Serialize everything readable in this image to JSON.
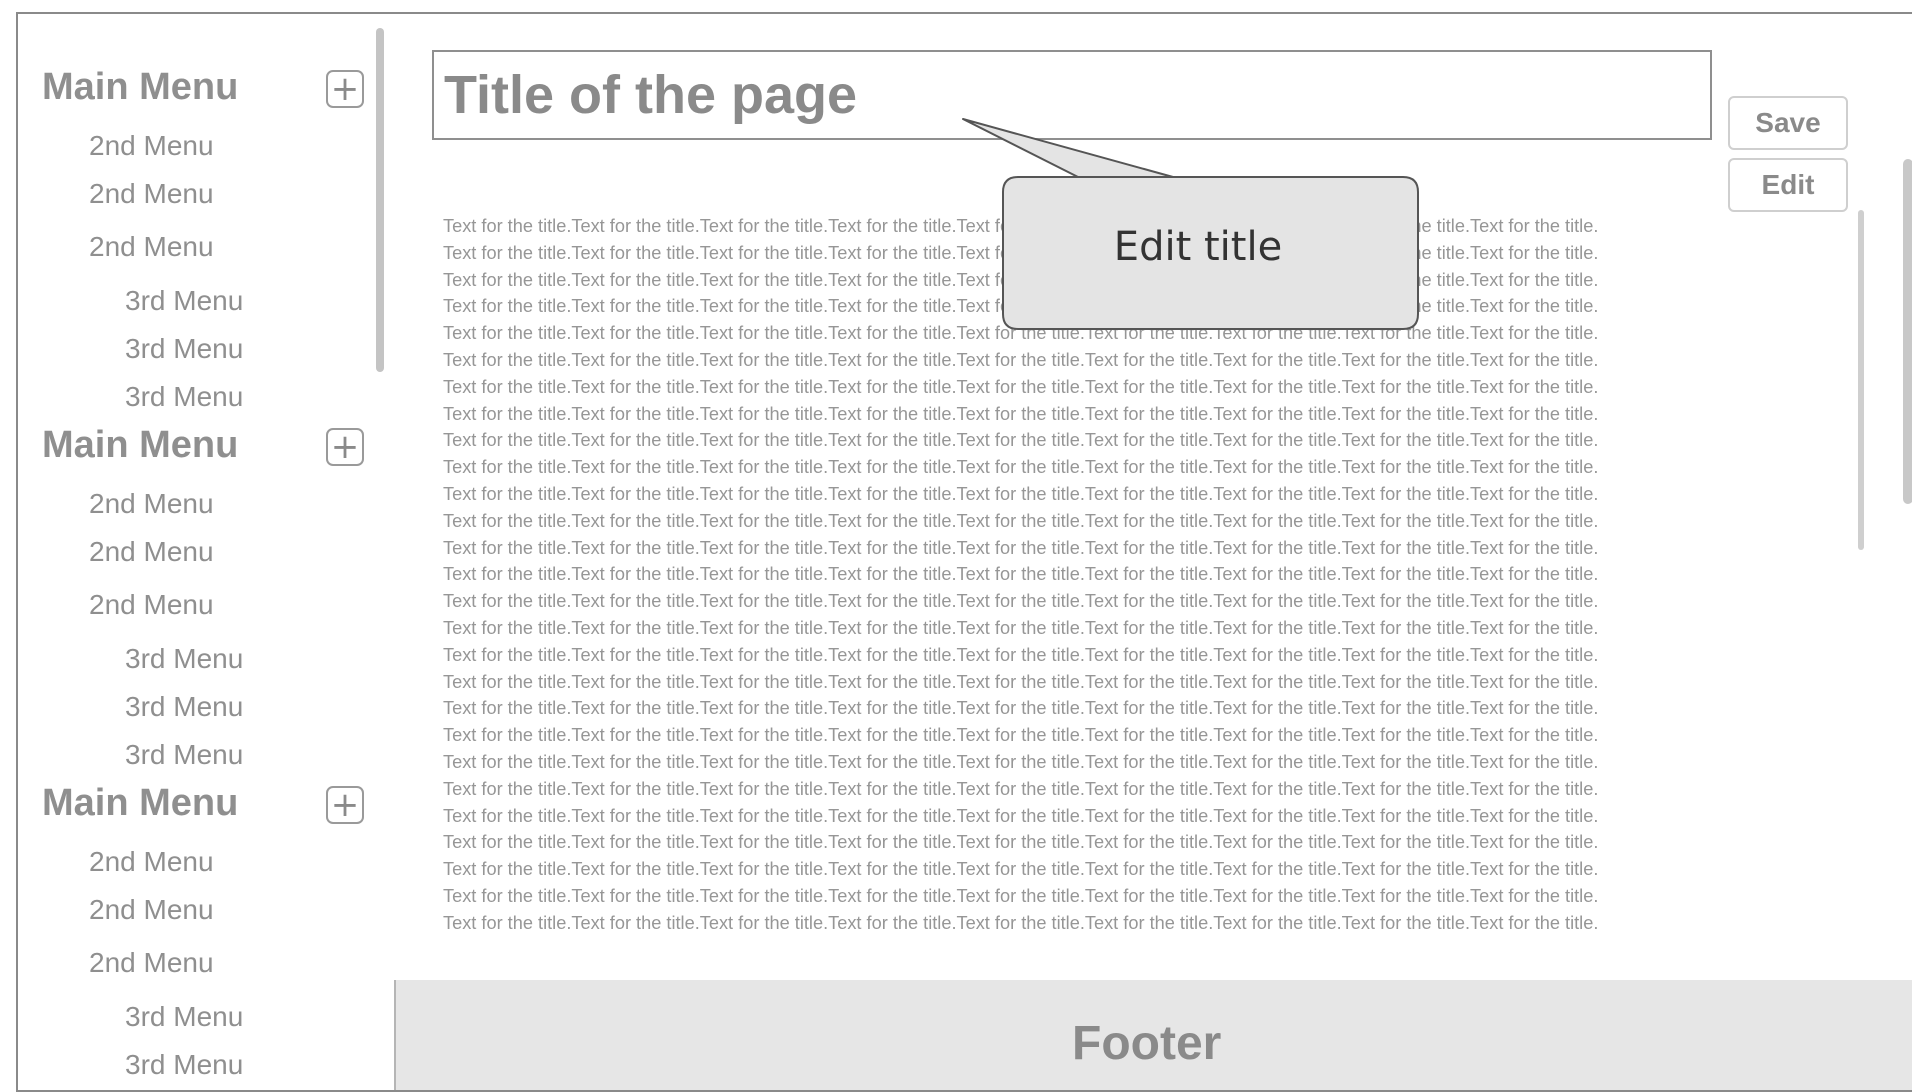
{
  "sidebar": {
    "groups": [
      {
        "main": "Main Menu",
        "add_icon": "plus-icon",
        "items": [
          {
            "label": "2nd Menu",
            "level": 2
          },
          {
            "label": "2nd Menu",
            "level": 2
          },
          {
            "label": "2nd Menu",
            "level": 2
          },
          {
            "label": "3rd Menu",
            "level": 3
          },
          {
            "label": "3rd Menu",
            "level": 3
          },
          {
            "label": "3rd Menu",
            "level": 3
          }
        ]
      },
      {
        "main": "Main Menu",
        "add_icon": "plus-icon",
        "items": [
          {
            "label": "2nd Menu",
            "level": 2
          },
          {
            "label": "2nd Menu",
            "level": 2
          },
          {
            "label": "2nd Menu",
            "level": 2
          },
          {
            "label": "3rd Menu",
            "level": 3
          },
          {
            "label": "3rd Menu",
            "level": 3
          },
          {
            "label": "3rd Menu",
            "level": 3
          }
        ]
      },
      {
        "main": "Main Menu",
        "add_icon": "plus-icon",
        "items": [
          {
            "label": "2nd Menu",
            "level": 2
          },
          {
            "label": "2nd Menu",
            "level": 2
          },
          {
            "label": "2nd Menu",
            "level": 2
          },
          {
            "label": "3rd Menu",
            "level": 3
          },
          {
            "label": "3rd Menu",
            "level": 3
          }
        ]
      }
    ]
  },
  "page": {
    "title": "Title of the page",
    "save_label": "Save",
    "edit_label": "Edit",
    "body_line": "Text for the title.Text for the title.Text for the title.Text for the title.Text for the title.Text for the title.Text for the title.Text for the title.Text for the title.",
    "body_line_count": 27
  },
  "callout": {
    "text": "Edit title"
  },
  "footer": {
    "text": "Footer"
  },
  "colors": {
    "text_gray": "#8f8f8f",
    "border_gray": "#8a8a8a",
    "footer_bg": "#e6e6e6",
    "callout_bg": "#e4e4e4"
  }
}
